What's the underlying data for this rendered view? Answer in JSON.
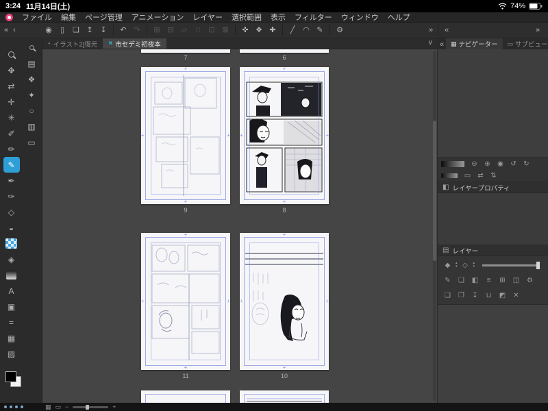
{
  "status_bar": {
    "time": "3:24",
    "date": "11月14日(土)",
    "battery": "74%"
  },
  "menu_bar": {
    "items": [
      "ファイル",
      "編集",
      "ページ管理",
      "アニメーション",
      "レイヤー",
      "選択範囲",
      "表示",
      "フィルター",
      "ウィンドウ",
      "ヘルプ"
    ]
  },
  "main_toolbar": {
    "icons": [
      {
        "name": "collapse-toolbar-icon",
        "glyph": "«"
      },
      {
        "name": "collapse-toolbar-small-icon",
        "glyph": "‹"
      },
      {
        "name": "quick-access-icon",
        "glyph": "◉"
      },
      {
        "name": "device-icon",
        "glyph": "▯"
      },
      {
        "name": "open-file-icon",
        "glyph": "❏"
      },
      {
        "name": "export-icon",
        "glyph": "↥"
      },
      {
        "name": "import-icon",
        "glyph": "↧"
      },
      {
        "name": "undo-icon",
        "glyph": "↶"
      },
      {
        "name": "redo-icon",
        "glyph": "↷"
      },
      {
        "name": "scale-transform-icon",
        "glyph": "⊞"
      },
      {
        "name": "rotate-transform-icon",
        "glyph": "⊟"
      },
      {
        "name": "skew-transform-icon",
        "glyph": "▱"
      },
      {
        "name": "mesh-transform-icon",
        "glyph": "∷"
      },
      {
        "name": "crop-icon",
        "glyph": "⊡"
      },
      {
        "name": "clear-selection-icon",
        "glyph": "⊠"
      },
      {
        "name": "snap-ruler-icon",
        "glyph": "✜"
      },
      {
        "name": "snap-grid-icon",
        "glyph": "❖"
      },
      {
        "name": "snap-special-icon",
        "glyph": "✚"
      },
      {
        "name": "straight-line-icon",
        "glyph": "╱"
      },
      {
        "name": "curve-icon",
        "glyph": "◠"
      },
      {
        "name": "draw-line-icon",
        "glyph": "✎"
      },
      {
        "name": "settings-gear-icon",
        "glyph": "⚙"
      },
      {
        "name": "expand-toolbar-icon",
        "glyph": "»"
      },
      {
        "name": "panel-collapse-icon",
        "glyph": "«"
      },
      {
        "name": "panel-expand-icon",
        "glyph": "»"
      }
    ]
  },
  "doc_tabs": {
    "tab1_dot": "●",
    "tab1_label": "イラスト2[復元",
    "tab2_close": "×",
    "tab2_label": "市セデミ初夜本",
    "overflow_chevron": "∨"
  },
  "tool_strip": {
    "primary": [
      {
        "name": "zoom-tool",
        "glyph": ""
      },
      {
        "name": "hand-tool",
        "glyph": "✥"
      },
      {
        "name": "flip-view-tool",
        "glyph": "⇄"
      },
      {
        "name": "move-tool",
        "glyph": "✛"
      },
      {
        "name": "auto-select-tool",
        "glyph": "✳"
      },
      {
        "name": "eyedropper-tool",
        "glyph": "✐"
      },
      {
        "name": "pencil-tool",
        "glyph": "✏"
      },
      {
        "name": "marker-tool",
        "glyph": "✎"
      },
      {
        "name": "pen-tool",
        "glyph": "✒"
      },
      {
        "name": "brush-tool",
        "glyph": "✑"
      },
      {
        "name": "eraser-tool",
        "glyph": "◇"
      },
      {
        "name": "blend-tool",
        "glyph": "◒"
      },
      {
        "name": "tone-tool",
        "glyph": ""
      },
      {
        "name": "fill-tool",
        "glyph": "◈"
      },
      {
        "name": "gradient-tool",
        "glyph": ""
      },
      {
        "name": "text-tool",
        "glyph": "A"
      },
      {
        "name": "balloon-tool",
        "glyph": "▣"
      },
      {
        "name": "dash-tool",
        "glyph": "="
      },
      {
        "name": "frame-border-tool",
        "glyph": "▦"
      },
      {
        "name": "ruler-tool",
        "glyph": "▨"
      }
    ],
    "secondary": [
      {
        "name": "subtool-zoom-icon",
        "glyph": "◎"
      },
      {
        "name": "layer-stack-icon",
        "glyph": "▤"
      },
      {
        "name": "mesh-icon",
        "glyph": "❖"
      },
      {
        "name": "polygon-icon",
        "glyph": "✦"
      },
      {
        "name": "circle-icon",
        "glyph": "○"
      },
      {
        "name": "pages-icon",
        "glyph": "▥"
      },
      {
        "name": "monitor-icon",
        "glyph": "▭"
      }
    ]
  },
  "canvas": {
    "rows": [
      {
        "left": "7",
        "right": "6"
      },
      {
        "left": "9",
        "right": "8"
      },
      {
        "left": "11",
        "right": "10"
      }
    ]
  },
  "right_panel": {
    "collapse_icon": "«",
    "navigator_icon": "▦",
    "navigator_tab": "ナビゲーター",
    "subview_icon": "▭",
    "subview_tab": "サブビュー",
    "nav_row1": [
      {
        "name": "zoom-out-icon",
        "glyph": "⊖"
      },
      {
        "name": "zoom-in-icon",
        "glyph": "⊕"
      },
      {
        "name": "reset-zoom-icon",
        "glyph": "◉"
      },
      {
        "name": "rotate-left-icon",
        "glyph": "↺"
      },
      {
        "name": "rotate-right-icon",
        "glyph": "↻"
      }
    ],
    "nav_row2": [
      {
        "name": "fit-screen-icon",
        "glyph": "▭"
      },
      {
        "name": "flip-horizontal-icon",
        "glyph": "⇄"
      },
      {
        "name": "flip-vertical-icon",
        "glyph": "⇅"
      }
    ],
    "layer_property_icon": "◧",
    "layer_property_title": "レイヤープロパティ",
    "layers_icon": "▤",
    "layers_title": "レイヤー",
    "blend_stepper_glyph": "◆",
    "effect_stepper_glyph": "◇",
    "stepper_up": "▴",
    "stepper_down": "▾",
    "layer_ops_row": [
      {
        "name": "edit-layer-icon",
        "glyph": "✎"
      },
      {
        "name": "duplicate-layer-icon",
        "glyph": "❏"
      },
      {
        "name": "layer-mask-icon",
        "glyph": "◧"
      },
      {
        "name": "layer-list-icon",
        "glyph": "≡"
      },
      {
        "name": "layer-grid-icon",
        "glyph": "⊞"
      },
      {
        "name": "split-view-icon",
        "glyph": "◫"
      },
      {
        "name": "layer-settings-icon",
        "glyph": "⚙"
      }
    ],
    "layer_new_row": [
      {
        "name": "new-layer-icon",
        "glyph": "❑"
      },
      {
        "name": "new-folder-icon",
        "glyph": "❒"
      },
      {
        "name": "transfer-layer-icon",
        "glyph": "↧"
      },
      {
        "name": "merge-layer-icon",
        "glyph": "⊔"
      },
      {
        "name": "mask-layer-icon",
        "glyph": "◩"
      },
      {
        "name": "delete-layer-icon",
        "glyph": "✕"
      }
    ]
  },
  "bottom_bar": {
    "view_icons": [
      {
        "name": "grid-view-icon",
        "glyph": "▦"
      },
      {
        "name": "single-view-icon",
        "glyph": "▭"
      }
    ],
    "zoom_out": "−",
    "zoom_in": "+"
  },
  "colors": {
    "accent": "#2fa8d8",
    "guide": "#8a96e0",
    "page_bg": "#f6f6f8",
    "active_tool_bg": "#2e9fd6"
  }
}
